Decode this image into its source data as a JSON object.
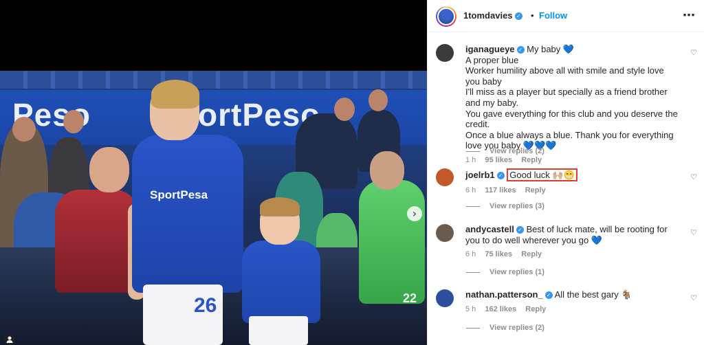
{
  "post": {
    "owner": "1tomdavies",
    "separator": "•",
    "follow_label": "Follow",
    "more_icon": "more-horizontal-icon",
    "photo": {
      "ad_board_texts": [
        "Peso",
        "ortPeso"
      ],
      "shirt_sponsor": "SportPesa",
      "shirt_number": "26",
      "goalkeeper_number": "22",
      "next_arrow": "›"
    }
  },
  "comments": [
    {
      "user": "iganagueye",
      "verified": true,
      "text": "My baby 💙\nA proper blue\nWorker humility above all with smile and style love you baby\nI'll miss as a player but specially as a friend brother and my baby.\nYou gave everything for this club and you deserve the credit.\nOnce a blue always a blue. Thank you for everything love you baby 💙💙💙",
      "time": "1 h",
      "likes": "95 likes",
      "reply_label": "Reply",
      "view_replies": "View replies (2)",
      "avatar_color": "#3b3b3b"
    },
    {
      "user": "joelrb1",
      "verified": true,
      "text": "Good luck 🙌🏼😁",
      "time": "6 h",
      "likes": "117 likes",
      "reply_label": "Reply",
      "view_replies": "View replies (3)",
      "avatar_color": "#c4582d"
    },
    {
      "user": "andycastell",
      "verified": true,
      "text": "Best of luck mate, will be rooting for you to do well wherever you go 💙",
      "time": "6 h",
      "likes": "75 likes",
      "reply_label": "Reply",
      "view_replies": "View replies (1)",
      "avatar_color": "#6b5b4e"
    },
    {
      "user": "nathan.patterson_",
      "verified": true,
      "text": "All the best gary 🐐",
      "time": "5 h",
      "likes": "162 likes",
      "reply_label": "Reply",
      "view_replies": "View replies (2)",
      "avatar_color": "#2d4f9e"
    }
  ],
  "colors": {
    "accent": "#0095f6",
    "verified": "#3897f0",
    "highlight": "#e23c2c",
    "muted": "#8e8e8e"
  }
}
